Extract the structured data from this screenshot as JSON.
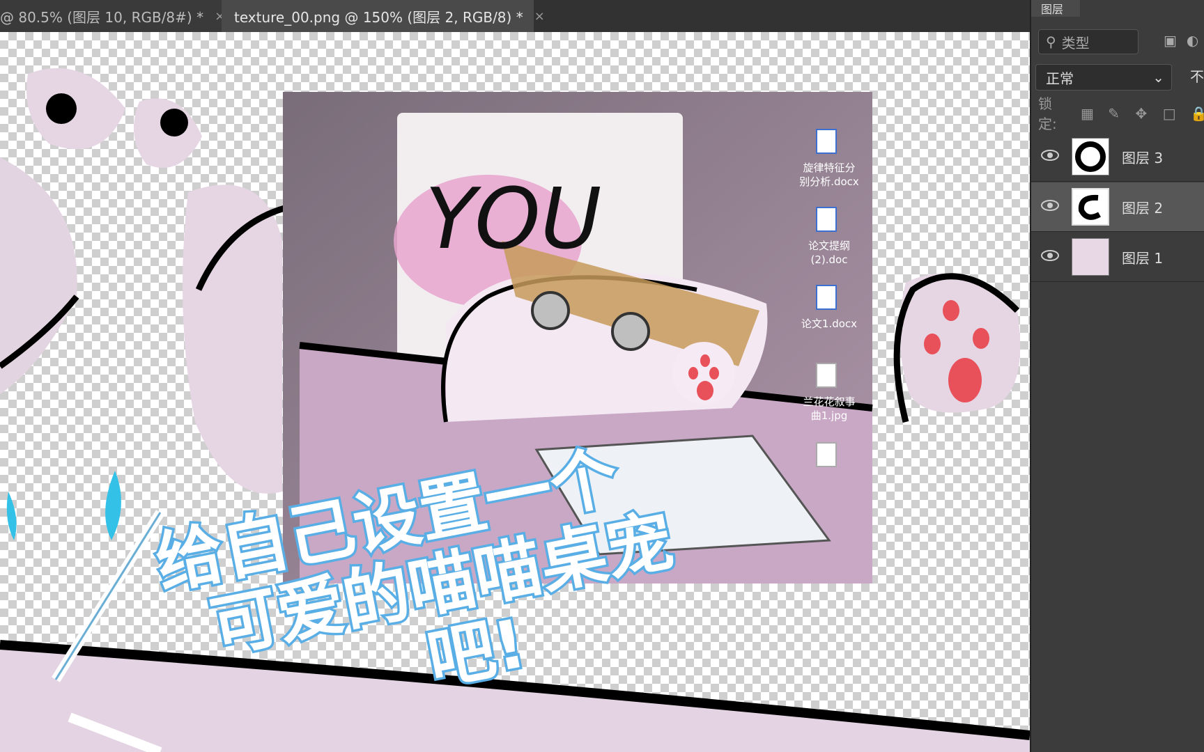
{
  "tabs": [
    {
      "label": "@ 80.5% (图层 10, RGB/8#) *",
      "close": "×"
    },
    {
      "label": "texture_00.png @ 150% (图层 2, RGB/8) *",
      "close": "×"
    }
  ],
  "panel": {
    "tab_label": "图层",
    "filter_placeholder": "类型",
    "blend_mode": "正常",
    "opacity_label": "不",
    "lock_label": "锁定:",
    "layers": [
      {
        "name": "图层 3",
        "visible": true,
        "selected": false
      },
      {
        "name": "图层 2",
        "visible": true,
        "selected": true
      },
      {
        "name": "图层 1",
        "visible": true,
        "selected": false
      }
    ]
  },
  "desktop_files": [
    {
      "name": "旋律特征分\n别分析.docx",
      "icon": "word-doc-icon"
    },
    {
      "name": "论文提纲\n(2).doc",
      "icon": "word-doc-icon"
    },
    {
      "name": "论文1.docx",
      "icon": "word-doc-icon"
    },
    {
      "name": "兰花花叙事\n曲1.jpg",
      "icon": "image-file-icon"
    }
  ],
  "artwork_text": "YOU",
  "caption_lines": [
    "给自己设置一个",
    "可爱的喵喵桌宠",
    "吧!"
  ],
  "colors": {
    "caption_fill": "#ffffff",
    "caption_stroke": "#5aaee6",
    "accent_pink": "#e8d7e6"
  }
}
